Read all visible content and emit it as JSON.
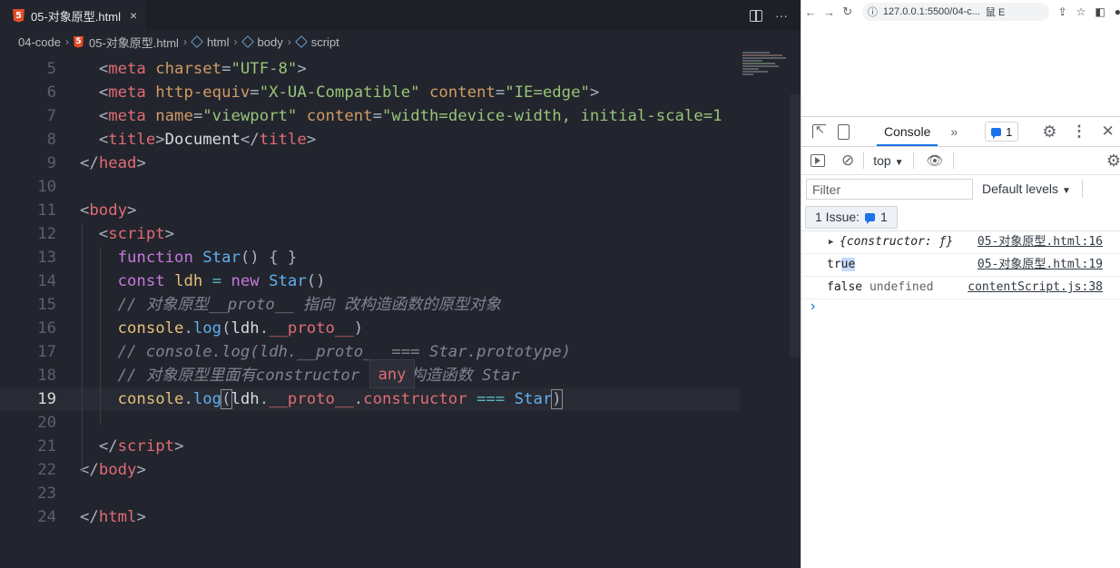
{
  "editor": {
    "tab_label": "05-对象原型.html",
    "tab_close": "×",
    "tab_more": "···",
    "breadcrumb": [
      "04-code",
      "05-对象原型.html",
      "html",
      "body",
      "script"
    ],
    "tooltip": "any",
    "lines": [
      {
        "n": "5"
      },
      {
        "n": "6"
      },
      {
        "n": "7"
      },
      {
        "n": "8"
      },
      {
        "n": "9"
      },
      {
        "n": "10"
      },
      {
        "n": "11"
      },
      {
        "n": "12"
      },
      {
        "n": "13"
      },
      {
        "n": "14"
      },
      {
        "n": "15"
      },
      {
        "n": "16"
      },
      {
        "n": "17"
      },
      {
        "n": "18"
      },
      {
        "n": "19"
      },
      {
        "n": "20"
      },
      {
        "n": "21"
      },
      {
        "n": "22"
      },
      {
        "n": "23"
      },
      {
        "n": "24"
      }
    ]
  },
  "browser": {
    "url": "127.0.0.1:5500/04-c...",
    "url_side": "鼠  E",
    "devtools": {
      "console_tab": "Console",
      "messages_count": "1",
      "context": "top",
      "filter_placeholder": "Filter",
      "default_levels": "Default levels",
      "issues_label": "1 Issue:",
      "issues_count": "1",
      "logs": [
        {
          "msg": "{constructor: ƒ}",
          "src": "05-对象原型.html:16"
        },
        {
          "msg_a": "tr",
          "msg_b": "ue",
          "src": "05-对象原型.html:19"
        },
        {
          "msg_a": "false",
          "msg_b": "undefined",
          "src": "contentScript.js:38"
        }
      ]
    }
  }
}
